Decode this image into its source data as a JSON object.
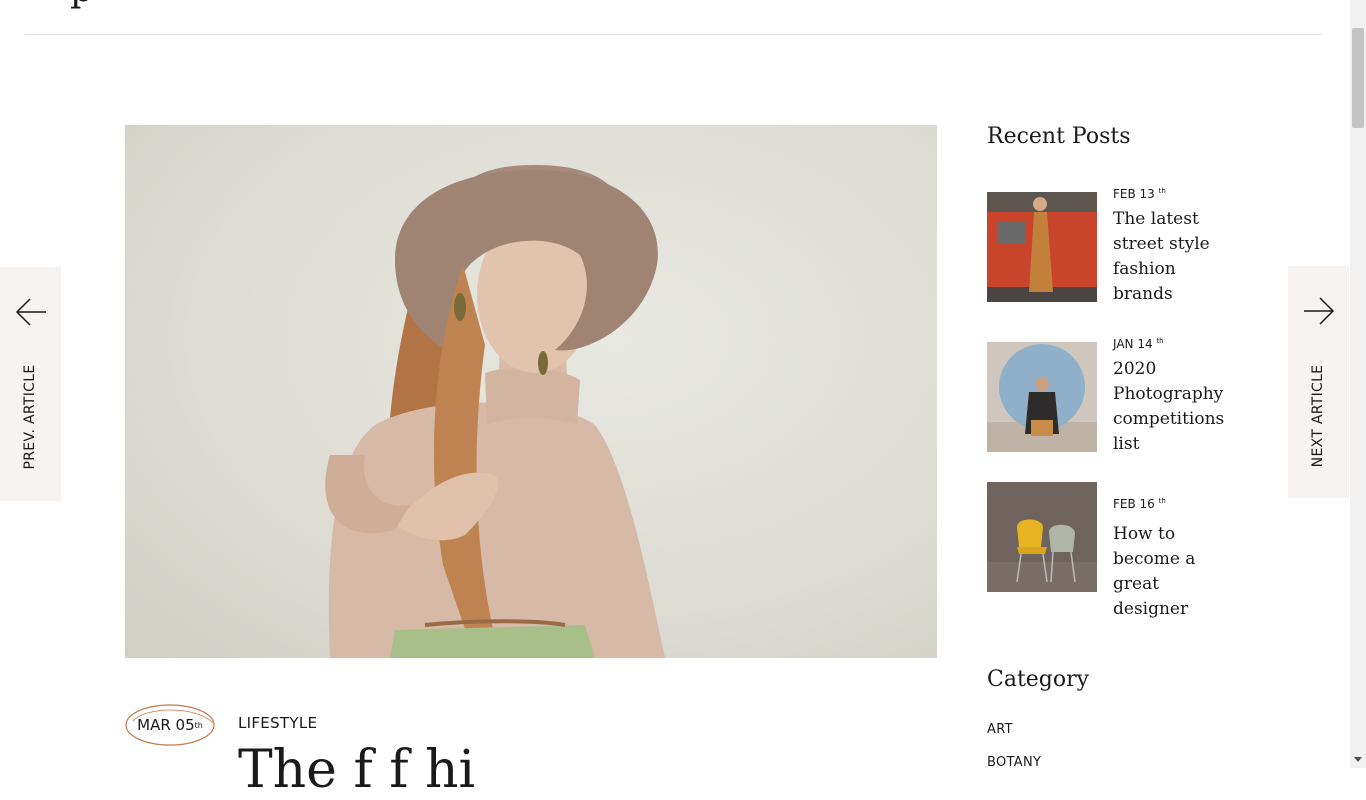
{
  "header": {
    "logo_fragment": "p"
  },
  "navigation": {
    "prev_label": "PREV. ARTICLE",
    "next_label": "NEXT ARTICLE"
  },
  "article": {
    "date": "MAR 05",
    "date_suffix": "th",
    "category": "LIFESTYLE",
    "title_partial": "The        f f  hi"
  },
  "sidebar": {
    "recent_heading": "Recent Posts",
    "recent_posts": [
      {
        "date": "FEB 13",
        "suffix": "th",
        "title": "The latest street style fashion brands"
      },
      {
        "date": "JAN 14",
        "suffix": "th",
        "title": "2020 Photography competitions list"
      },
      {
        "date": "FEB 16",
        "suffix": "th",
        "title": "How to become a great designer"
      }
    ],
    "category_heading": "Category",
    "categories": [
      "ART",
      "BOTANY"
    ]
  },
  "colors": {
    "accent_circle": "#c47a4a",
    "side_tab_bg": "#f7f3f1"
  }
}
